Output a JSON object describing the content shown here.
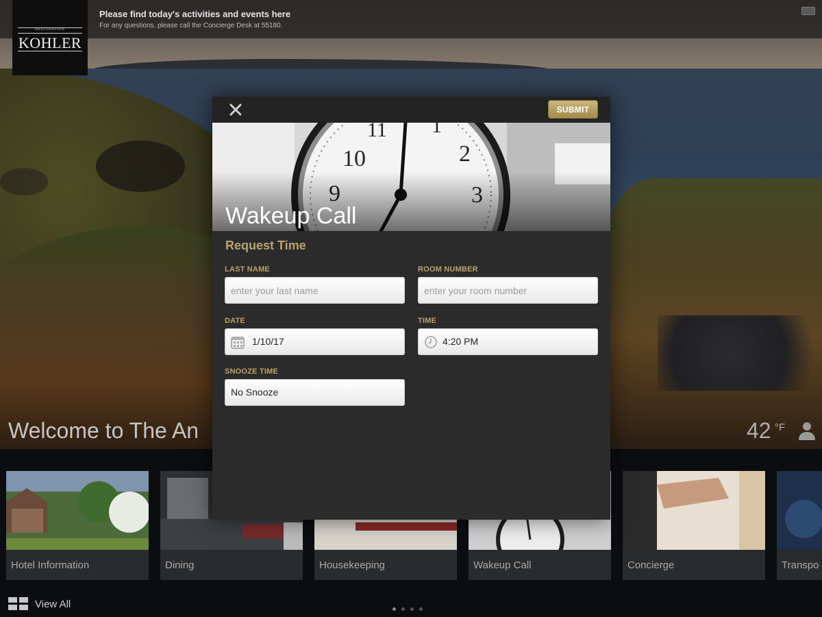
{
  "banner": {
    "title": "Please find today's activities and events here",
    "subtitle": "For any questions, please call the Concierge Desk at 55180."
  },
  "logo": {
    "top_text": "DESTINATION",
    "word": "KOHLER"
  },
  "welcome": {
    "text": "Welcome to The An"
  },
  "weather": {
    "temperature": "42",
    "unit": "°F"
  },
  "modal": {
    "close_icon": "close-icon",
    "submit_label": "SUBMIT",
    "title": "Wakeup Call",
    "section_title": "Request Time",
    "fields": {
      "last_name": {
        "label": "LAST NAME",
        "placeholder": "enter your last name",
        "value": ""
      },
      "room_number": {
        "label": "ROOM NUMBER",
        "placeholder": "enter your room number",
        "value": ""
      },
      "date": {
        "label": "DATE",
        "value": "1/10/17",
        "icon": "calendar-icon"
      },
      "time": {
        "label": "TIME",
        "value": "4:20 PM",
        "icon": "clock-icon"
      },
      "snooze": {
        "label": "SNOOZE TIME",
        "value": "No Snooze"
      }
    }
  },
  "tiles": [
    {
      "label": "Hotel Information"
    },
    {
      "label": "Dining"
    },
    {
      "label": "Housekeeping"
    },
    {
      "label": "Wakeup Call"
    },
    {
      "label": "Concierge"
    },
    {
      "label": "Transpo"
    }
  ],
  "footer": {
    "view_all_label": "View All",
    "view_all_icon": "grid-icon",
    "page_count": 4,
    "current_page": 1
  },
  "colors": {
    "accent_gold": "#b8a46c",
    "submit_gold": "#a48b4e",
    "modal_bg": "#2b2b2b"
  }
}
